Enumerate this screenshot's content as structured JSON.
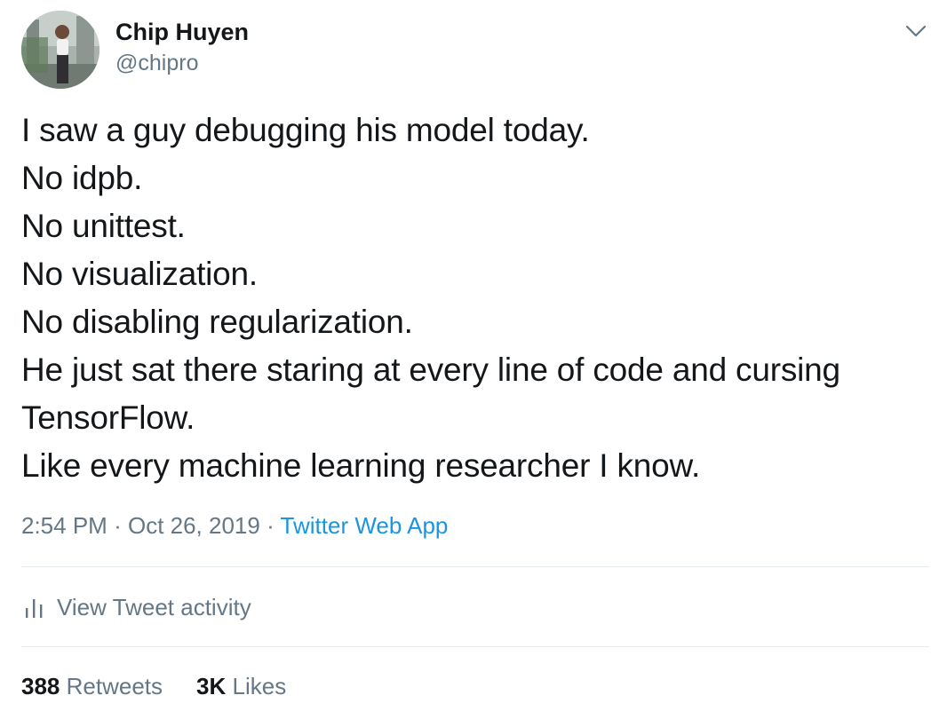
{
  "author": {
    "name": "Chip Huyen",
    "handle": "@chipro"
  },
  "tweet": {
    "lines": [
      "I saw a guy debugging his model today.",
      "No idpb.",
      "No unittest.",
      "No visualization.",
      "No disabling regularization.",
      "He just sat there staring at every line of code and cursing",
      "TensorFlow.",
      "Like every machine learning researcher I know."
    ]
  },
  "meta": {
    "time": "2:54 PM",
    "separator": "·",
    "date": "Oct 26, 2019",
    "source": "Twitter Web App"
  },
  "activity": {
    "label": "View Tweet activity",
    "icon": "bar-chart-icon"
  },
  "stats": {
    "retweets_count": "388",
    "retweets_label": "Retweets",
    "likes_count": "3K",
    "likes_label": "Likes"
  },
  "colors": {
    "text": "#14171a",
    "secondary": "#657786",
    "link": "#1b95e0",
    "divider": "#e6ecf0"
  }
}
